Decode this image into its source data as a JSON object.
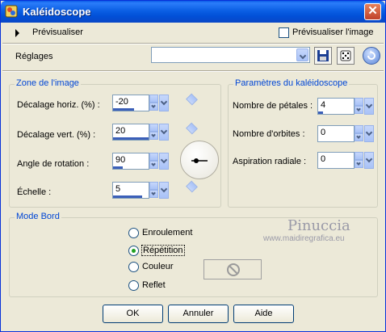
{
  "window": {
    "title": "Kaléidoscope"
  },
  "preview": {
    "label": "Prévisualiser",
    "checkbox_label": "Prévisualiser l'image",
    "checked": false
  },
  "settings": {
    "label": "Réglages",
    "value": ""
  },
  "image_zone": {
    "legend": "Zone de l'image",
    "fields": [
      {
        "label": "Décalage horiz. (%) :",
        "value": "-20"
      },
      {
        "label": "Décalage vert. (%) :",
        "value": "20"
      },
      {
        "label": "Angle de rotation :",
        "value": "90"
      },
      {
        "label": "Échelle :",
        "value": "5"
      }
    ]
  },
  "kaleido_params": {
    "legend": "Paramètres du kaléidoscope",
    "fields": [
      {
        "label": "Nombre de pétales :",
        "value": "4"
      },
      {
        "label": "Nombre d'orbites :",
        "value": "0"
      },
      {
        "label": "Aspiration radiale :",
        "value": "0"
      }
    ]
  },
  "mode_bord": {
    "legend": "Mode Bord",
    "options": [
      {
        "label": "Enroulement",
        "selected": false
      },
      {
        "label": "Répétition",
        "selected": true
      },
      {
        "label": "Couleur",
        "selected": false
      },
      {
        "label": "Reflet",
        "selected": false
      }
    ]
  },
  "watermark": {
    "name": "Pinuccia",
    "url": "www.maidiregrafica.eu"
  },
  "buttons": {
    "ok": "OK",
    "cancel": "Annuler",
    "help": "Aide"
  },
  "colors": {
    "titlebar": "#0054e3",
    "accent": "#0046d5",
    "selected_radio": "#21a121"
  }
}
